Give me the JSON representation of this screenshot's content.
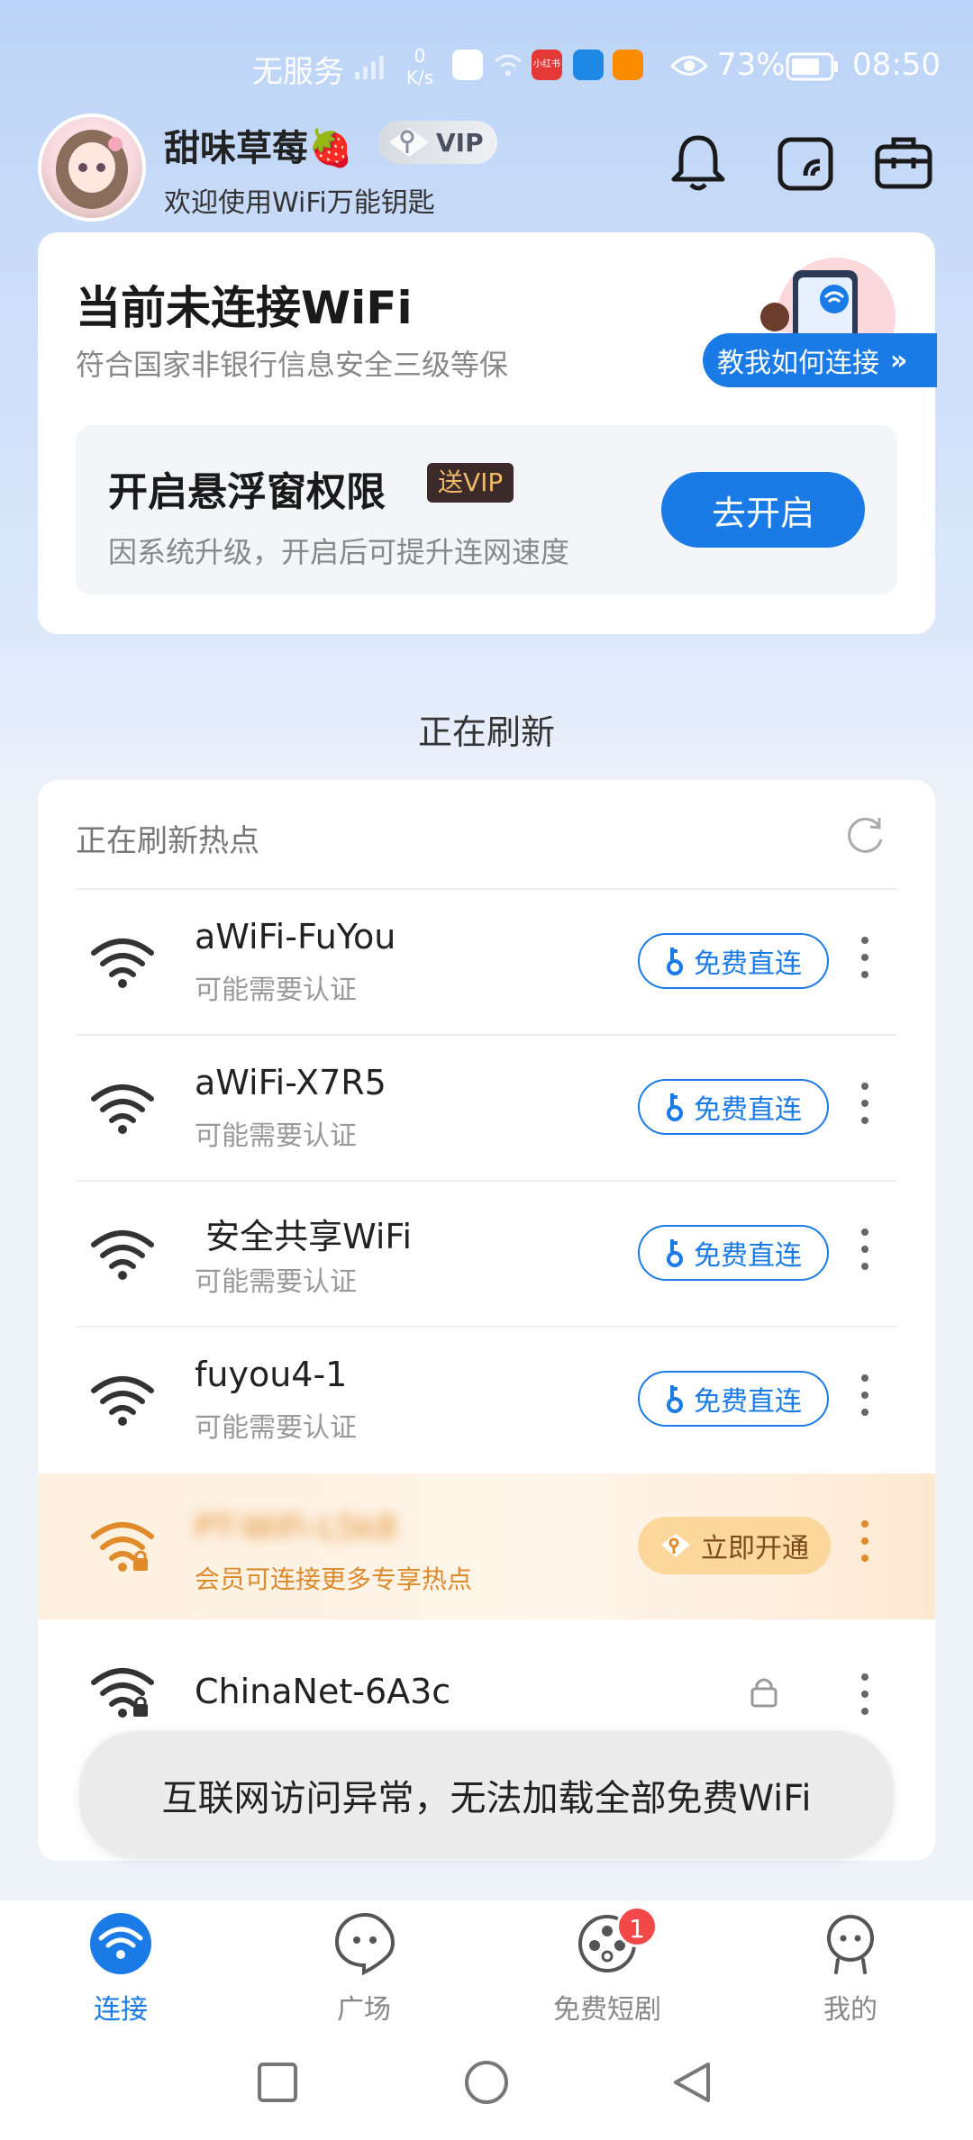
{
  "status_bar": {
    "carrier": "无服务",
    "net_speed_value": "0",
    "net_speed_unit": "K/s",
    "app_badge_text": "小红书",
    "battery": "73%",
    "time": "08:50"
  },
  "header": {
    "username": "甜味草莓🍓",
    "vip_label": "VIP",
    "welcome": "欢迎使用WiFi万能钥匙"
  },
  "status_card": {
    "title": "当前未连接WiFi",
    "subtitle": "符合国家非银行信息安全三级等保",
    "teach_label": "教我如何连接",
    "teach_arrows": "»",
    "permission": {
      "title": "开启悬浮窗权限",
      "gift_badge": "送VIP",
      "subtitle": "因系统升级，开启后可提升连网速度",
      "button": "去开启"
    }
  },
  "refresh_status": "正在刷新",
  "list": {
    "header": "正在刷新热点",
    "networks": [
      {
        "ssid": "aWiFi-FuYou",
        "note": "可能需要认证",
        "action": "免费直连"
      },
      {
        "ssid": "aWiFi-X7R5",
        "note": "可能需要认证",
        "action": "免费直连"
      },
      {
        "ssid": " 安全共享WiFi",
        "note": "可能需要认证",
        "action": "免费直连"
      },
      {
        "ssid": "fuyou4-1",
        "note": "可能需要认证",
        "action": "免费直连"
      }
    ],
    "vip_network": {
      "ssid": "PT-WiFi-L5k8",
      "note": "会员可连接更多专享热点",
      "action": "立即开通"
    },
    "locked_network": {
      "ssid": "ChinaNet-6A3c"
    }
  },
  "toast": "互联网访问异常，无法加载全部免费WiFi",
  "bottom_nav": [
    {
      "label": "连接",
      "icon": "wifi-icon",
      "active": true
    },
    {
      "label": "广场",
      "icon": "chat-face-icon"
    },
    {
      "label": "免费短剧",
      "icon": "film-reel-icon",
      "badge": "1"
    },
    {
      "label": "我的",
      "icon": "profile-face-icon"
    }
  ],
  "colors": {
    "accent": "#1a7be6",
    "vip_orange": "#e08a2a",
    "badge_red": "#f24848"
  }
}
